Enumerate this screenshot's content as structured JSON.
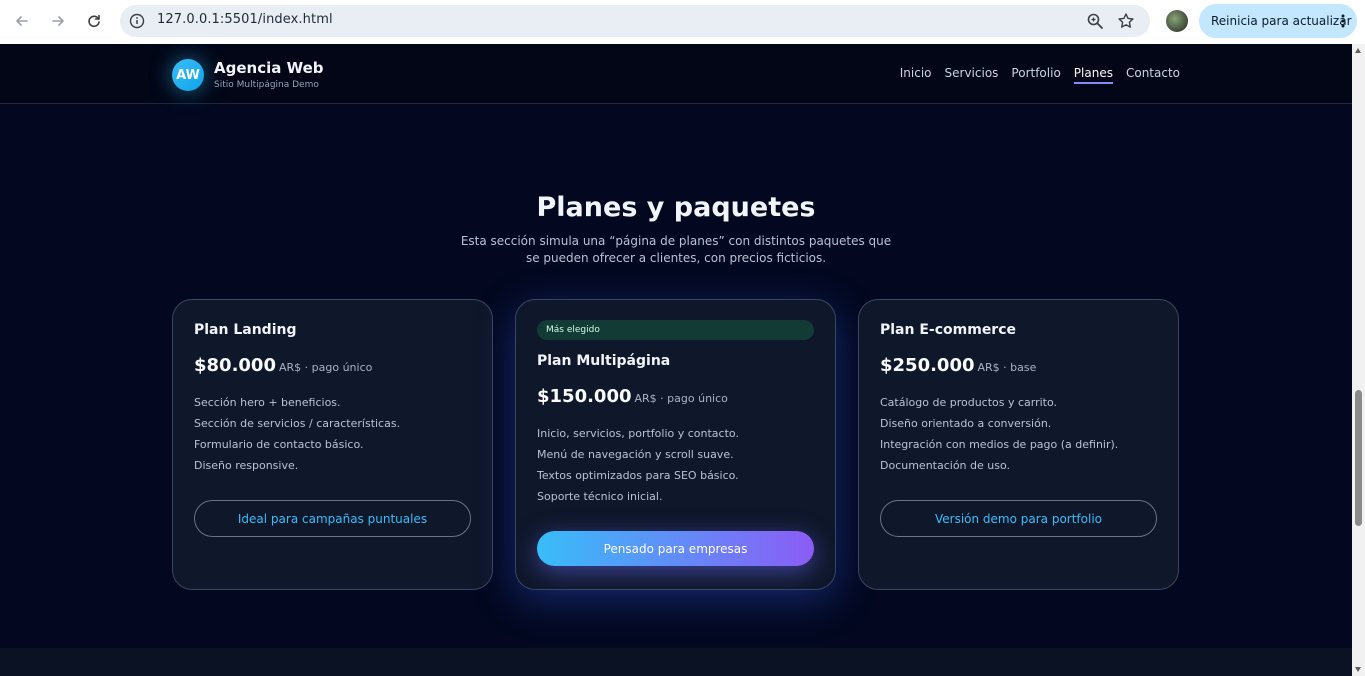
{
  "browser": {
    "url": "127.0.0.1:5501/index.html",
    "update_label": "Reinicia para actualizar"
  },
  "site": {
    "logo_initials": "AW",
    "brand_title": "Agencia Web",
    "brand_subtitle": "Sitio Multipágina Demo",
    "nav": [
      {
        "label": "Inicio",
        "active": false
      },
      {
        "label": "Servicios",
        "active": false
      },
      {
        "label": "Portfolio",
        "active": false
      },
      {
        "label": "Planes",
        "active": true
      },
      {
        "label": "Contacto",
        "active": false
      }
    ]
  },
  "section": {
    "title": "Planes y paquetes",
    "description": "Esta sección simula una “página de planes” con distintos paquetes que se pueden ofrecer a clientes, con precios ficticios."
  },
  "plans": [
    {
      "name": "Plan Landing",
      "price": "$80.000",
      "price_note": "AR$ · pago único",
      "features": [
        "Sección hero + beneficios.",
        "Sección de servicios / características.",
        "Formulario de contacto básico.",
        "Diseño responsive."
      ],
      "cta": "Ideal para campañas puntuales"
    },
    {
      "badge": "Más elegido",
      "name": "Plan Multipágina",
      "price": "$150.000",
      "price_note": "AR$ · pago único",
      "features": [
        "Inicio, servicios, portfolio y contacto.",
        "Menú de navegación y scroll suave.",
        "Textos optimizados para SEO básico.",
        "Soporte técnico inicial."
      ],
      "cta": "Pensado para empresas"
    },
    {
      "name": "Plan E-commerce",
      "price": "$250.000",
      "price_note": "AR$ · base",
      "features": [
        "Catálogo de productos y carrito.",
        "Diseño orientado a conversión.",
        "Integración con medios de pago (a definir).",
        "Documentación de uso."
      ],
      "cta": "Versión demo para portfolio"
    }
  ],
  "colors": {
    "accent_blue": "#38bdf8",
    "accent_purple": "#8b5cf6",
    "background": "#030820"
  }
}
